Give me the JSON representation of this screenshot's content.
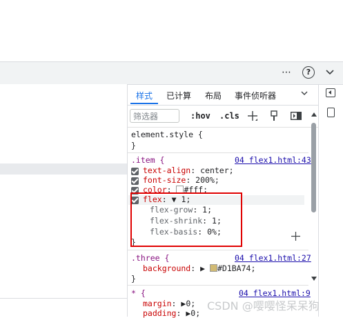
{
  "toolbar": {
    "more_icon": "more-icon",
    "help_icon": "help-icon",
    "collapse_icon": "chevron-down-icon"
  },
  "tabs": [
    {
      "label": "样式",
      "active": true
    },
    {
      "label": "已计算"
    },
    {
      "label": "布局"
    },
    {
      "label": "事件侦听器"
    }
  ],
  "filter": {
    "placeholder": "筛选器"
  },
  "tools": {
    "hov": ":hov",
    "cls": ".cls"
  },
  "rules": {
    "element_style": {
      "selector": "element.style {",
      "close": "}"
    },
    "item": {
      "selector": ".item {",
      "source": "04 flex1.html:43",
      "props": [
        {
          "name": "text-align",
          "value": "center;"
        },
        {
          "name": "font-size",
          "value": "200%;"
        },
        {
          "name": "color",
          "value": "#fff;"
        },
        {
          "name": "flex",
          "value": "1;"
        }
      ],
      "sub": [
        {
          "name": "flex-grow",
          "value": "1;"
        },
        {
          "name": "flex-shrink",
          "value": "1;"
        },
        {
          "name": "flex-basis",
          "value": "0%;"
        }
      ],
      "close": "}"
    },
    "three": {
      "selector": ".three {",
      "source": "04 flex1.html:27",
      "prop": {
        "name": "background",
        "value": "#D1BA74;"
      },
      "close": "}"
    },
    "universal": {
      "selector": "* {",
      "source": "04 flex1.html:9",
      "props": [
        {
          "name": "margin",
          "value": "0;"
        },
        {
          "name": "padding",
          "value": "0;"
        }
      ]
    }
  },
  "watermark": "CSDN @嘤嘤怪呆呆狗",
  "colors": {
    "swatch_white": "#ffffff",
    "swatch_three": "#D1BA74",
    "accent": "#1a73e8",
    "highlight_box": "#e00000"
  }
}
